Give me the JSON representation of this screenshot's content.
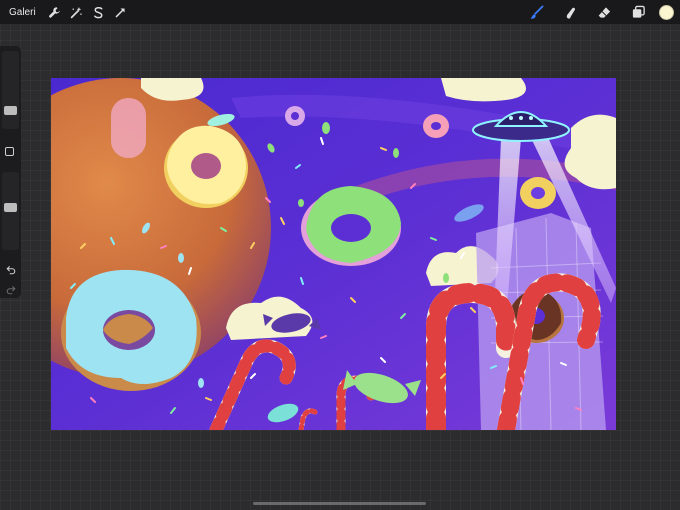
{
  "toolbar": {
    "gallery_label": "Galeri",
    "left_tools": [
      {
        "name": "actions-wrench-icon"
      },
      {
        "name": "adjustments-magic-wand-icon"
      },
      {
        "name": "selection-s-icon"
      },
      {
        "name": "transform-arrow-icon"
      }
    ],
    "right_tools": [
      {
        "name": "brush-icon",
        "active": true
      },
      {
        "name": "smudge-icon"
      },
      {
        "name": "eraser-icon"
      },
      {
        "name": "layers-icon"
      }
    ],
    "current_color": "#fbf6cf"
  },
  "sidebar": {
    "brush_size_level": 0.2,
    "opacity_level": 0.55
  },
  "colors": {
    "active_tool": "#3b7dff",
    "sky": "#5b2fd4",
    "planet": "#c86a3a"
  }
}
